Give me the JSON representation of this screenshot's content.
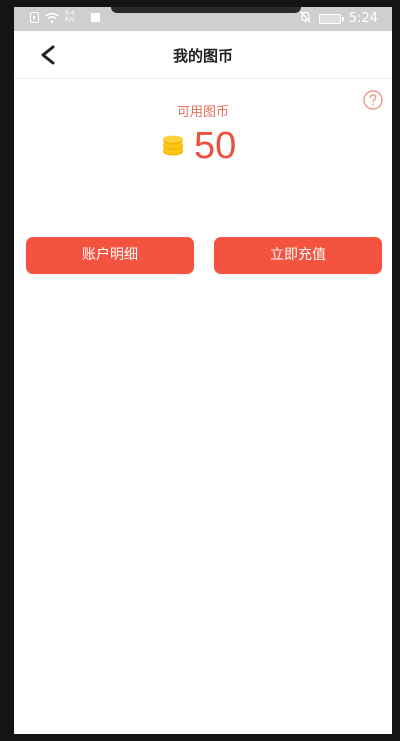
{
  "status_bar": {
    "speed_top": "9.4",
    "speed_bottom": "K/s",
    "time": "5:24"
  },
  "header": {
    "title": "我的图币",
    "back_icon": "chevron-left-icon"
  },
  "balance": {
    "label": "可用图币",
    "value": "50",
    "coin_color": "#f5b400",
    "value_color": "#e9523f",
    "help_icon": "question-circle-icon"
  },
  "actions": {
    "details_label": "账户明细",
    "recharge_label": "立即充值",
    "button_color": "#f4533f"
  }
}
